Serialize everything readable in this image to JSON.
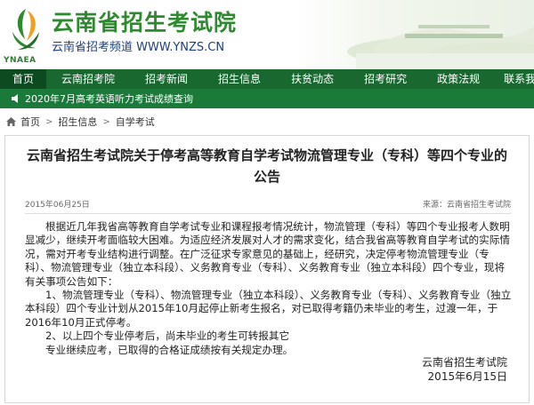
{
  "header": {
    "site_title": "云南省招生考试院",
    "site_subtitle": "云南省招考频道 WWW.YNZS.CN",
    "logo_caption": "YNAEA",
    "colors": {
      "title": "#2e8a2e",
      "subtitle": "#1f3f7a"
    }
  },
  "nav": {
    "items": [
      {
        "label": "首页",
        "active": true
      },
      {
        "label": "云南招考院"
      },
      {
        "label": "招考新闻"
      },
      {
        "label": "招生信息"
      },
      {
        "label": "扶贫动态"
      },
      {
        "label": "招考研究"
      },
      {
        "label": "政策法规"
      },
      {
        "label": "联系我们"
      }
    ],
    "colors": {
      "bar": "#196830",
      "active": "#0d4a1f"
    }
  },
  "ticker": {
    "text": "2020年7月高考英语听力考试成绩查询",
    "icon": "speaker-icon"
  },
  "breadcrumb": {
    "items": [
      "首页",
      "招生信息",
      "自学考试"
    ],
    "separator": ">"
  },
  "article": {
    "title": "云南省招生考试院关于停考高等教育自学考试物流管理专业（专科）等四个专业的公告",
    "date": "2015年06月25日",
    "source": "来源：云南省招生考试院",
    "paragraphs": [
      "根据近几年我省高等教育自学考试专业和课程报考情况统计，物流管理（专科）等四个专业报考人数明显减少，继续开考面临较大困难。为适应经济发展对人才的需求变化，结合我省高等教育自学考试的实际情况，需对开考专业结构进行调整。在广泛征求专家意见的基础上，经研究，决定停考物流管理专业（专科）、物流管理专业（独立本科段）、义务教育专业（专科）、义务教育专业（独立本科段）四个专业，现将有关事项公告如下：",
      "1、物流管理专业（专科）、物流管理专业（独立本科段）、义务教育专业（专科）、义务教育专业（独立本科段）四个专业计划从2015年10月起停止新考生报名，对已取得考籍仍未毕业的考生，过渡一年，于2016年10月正式停考。",
      "2、以上四个专业停考后，尚未毕业的考生可转报其它",
      "专业继续应考，已取得的合格证成绩按有关规定办理。"
    ],
    "signature": {
      "org": "云南省招生考试院",
      "date": "2015年6月15日"
    }
  }
}
